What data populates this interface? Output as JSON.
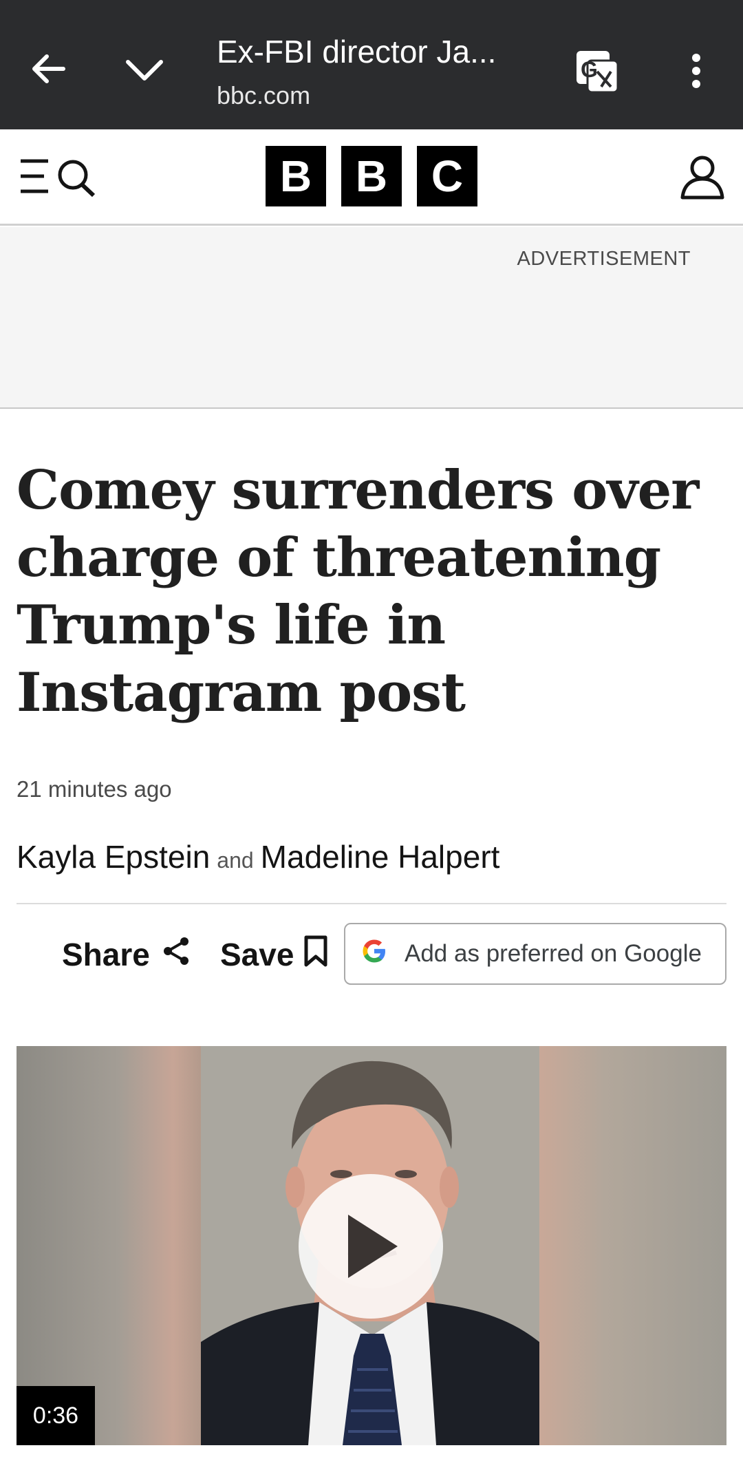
{
  "browser": {
    "title": "Ex-FBI director Ja...",
    "url": "bbc.com",
    "icons": [
      "back-arrow-icon",
      "chevron-down-icon",
      "translate-icon",
      "more-vertical-icon"
    ]
  },
  "header": {
    "logo_letters": [
      "B",
      "B",
      "C"
    ],
    "icons": [
      "menu-search-icon",
      "account-icon"
    ]
  },
  "ad": {
    "label": "ADVERTISEMENT"
  },
  "article": {
    "headline": "Comey surrenders over charge of threatening Trump's life in Instagram post",
    "timestamp": "21 minutes ago",
    "authors": [
      "Kayla Epstein",
      "Madeline Halpert"
    ],
    "author_joiner": "and"
  },
  "actions": {
    "share_label": "Share",
    "save_label": "Save",
    "google_label": "Add as preferred on Google"
  },
  "video": {
    "duration": "0:36"
  },
  "colors": {
    "browser_bar": "#2b2c2e",
    "logo_block": "#000000",
    "ad_background": "#f5f5f5",
    "text": "#202020"
  }
}
